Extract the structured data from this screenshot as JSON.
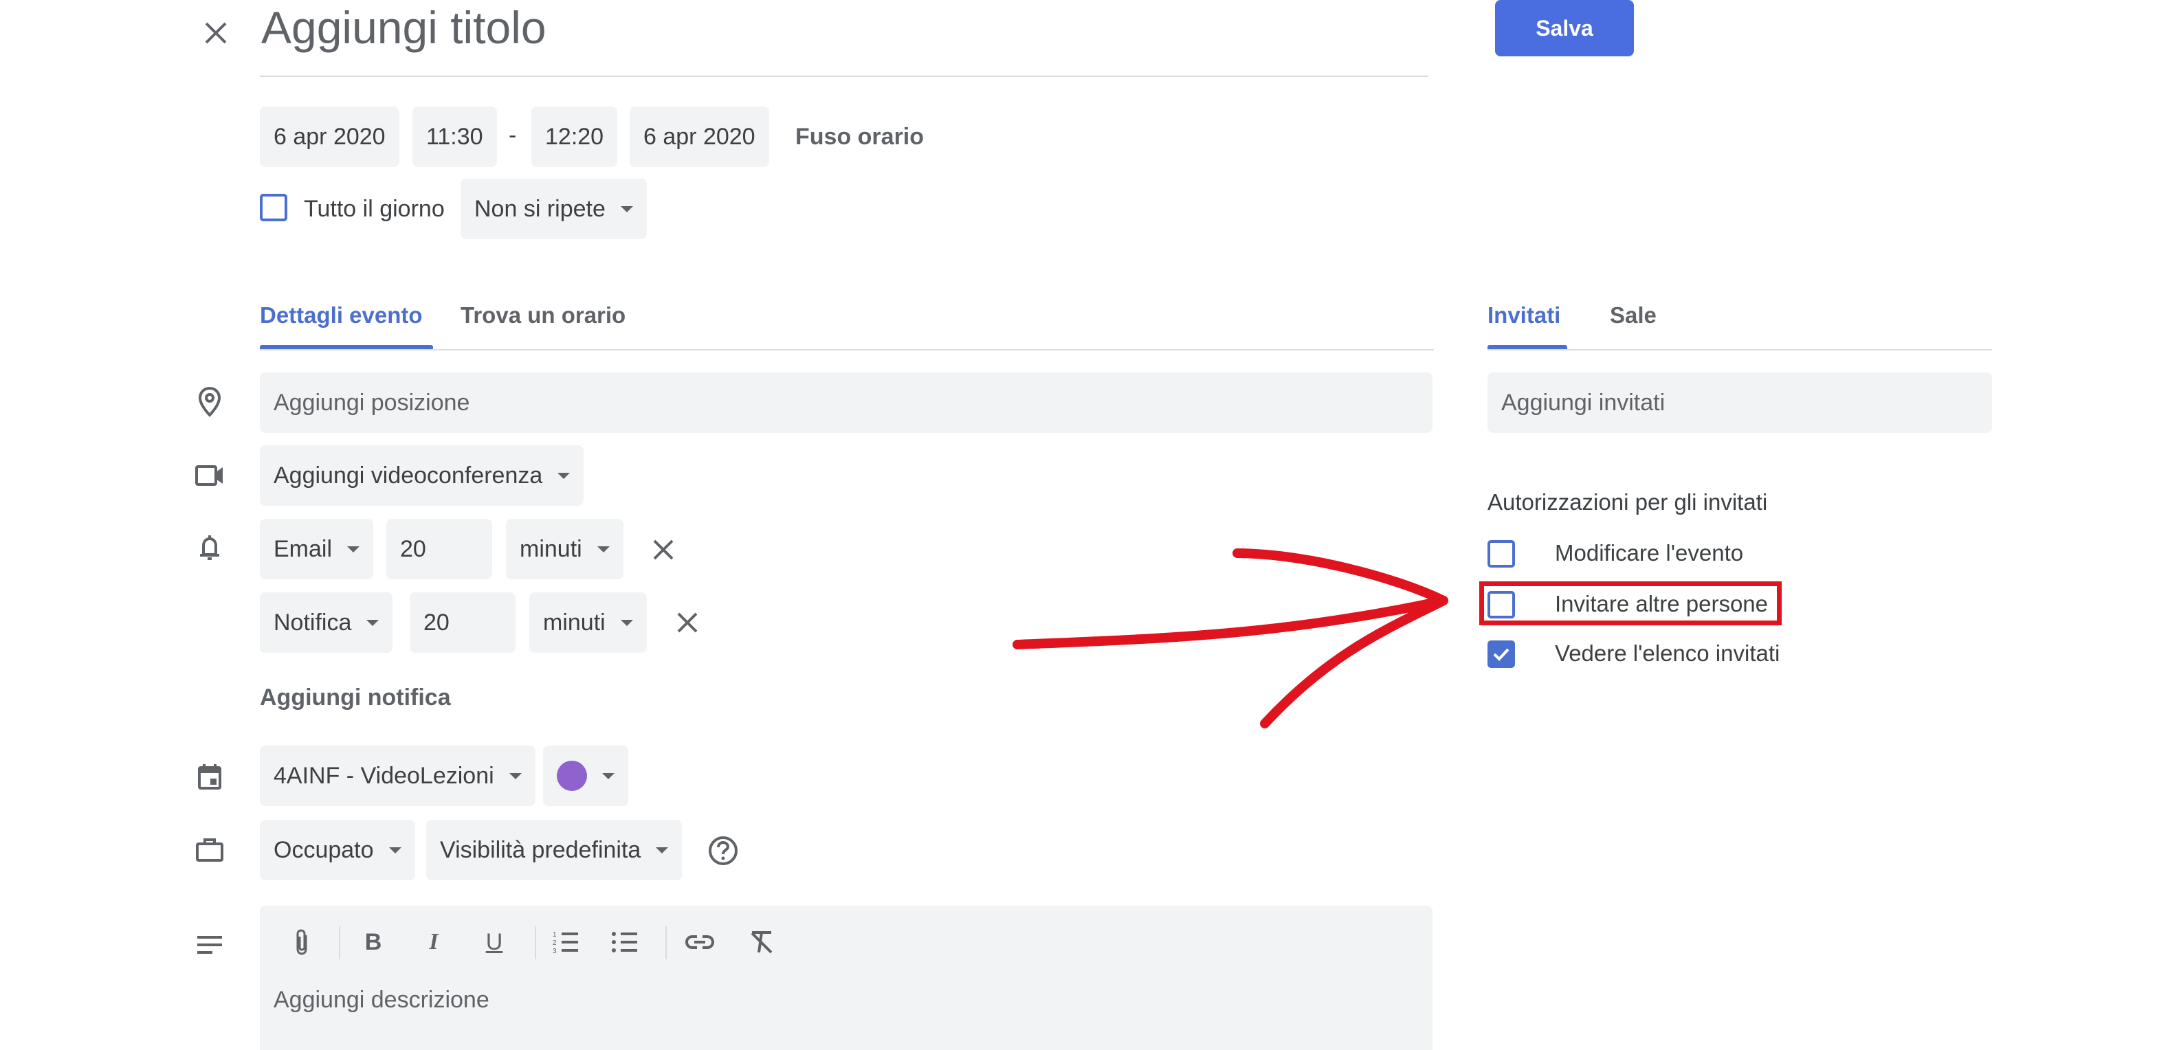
{
  "header": {
    "title_placeholder": "Aggiungi titolo",
    "save_label": "Salva"
  },
  "datetime": {
    "start_date": "6 apr 2020",
    "start_time": "11:30",
    "separator": "-",
    "end_time": "12:20",
    "end_date": "6 apr 2020",
    "timezone_label": "Fuso orario",
    "all_day_label": "Tutto il giorno",
    "all_day_checked": false,
    "repeat_label": "Non si ripete"
  },
  "tabs": {
    "details": "Dettagli evento",
    "find_time": "Trova un orario",
    "guests": "Invitati",
    "rooms": "Sale"
  },
  "details": {
    "location_placeholder": "Aggiungi posizione",
    "video_label": "Aggiungi videoconferenza",
    "notifications": [
      {
        "type": "Email",
        "value": "20",
        "unit": "minuti"
      },
      {
        "type": "Notifica",
        "value": "20",
        "unit": "minuti"
      }
    ],
    "add_notification": "Aggiungi notifica",
    "calendar_label": "4AINF - VideoLezioni",
    "calendar_color": "#8e63ce",
    "availability_label": "Occupato",
    "visibility_label": "Visibilità predefinita",
    "description_placeholder": "Aggiungi descrizione",
    "toolbar_icons": [
      "attach-icon",
      "bold-icon",
      "italic-icon",
      "underline-icon",
      "numbered-list-icon",
      "bulleted-list-icon",
      "link-icon",
      "clear-format-icon"
    ]
  },
  "guests": {
    "add_guests_placeholder": "Aggiungi invitati",
    "permissions_title": "Autorizzazioni per gli invitati",
    "permissions": [
      {
        "label": "Modificare l'evento",
        "checked": false
      },
      {
        "label": "Invitare altre persone",
        "checked": false
      },
      {
        "label": "Vedere l'elenco invitati",
        "checked": true
      }
    ]
  },
  "colors": {
    "accent": "#4a6fcf",
    "save_button": "#4a6ee0",
    "annotation_red": "#e0141e",
    "field_bg": "#f1f3f4"
  }
}
